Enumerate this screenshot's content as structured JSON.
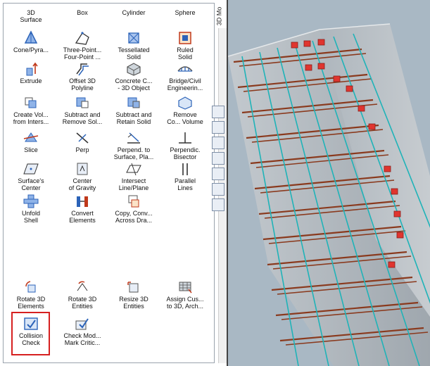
{
  "panel": {
    "vertical_title": "3D Mo",
    "tools": [
      {
        "id": "3d-surface",
        "label": "3D\nSurface",
        "icon": "surface-icon"
      },
      {
        "id": "box",
        "label": "Box",
        "icon": "box-icon"
      },
      {
        "id": "cylinder",
        "label": "Cylinder",
        "icon": "cylinder-icon"
      },
      {
        "id": "sphere",
        "label": "Sphere",
        "icon": "sphere-icon"
      },
      {
        "id": "cone",
        "label": "Cone/Pyra...",
        "icon": "cone-icon"
      },
      {
        "id": "three-point",
        "label": "Three-Point...\nFour-Point ...",
        "icon": "three-point-icon"
      },
      {
        "id": "tessellated",
        "label": "Tessellated\nSolid",
        "icon": "tessellated-icon"
      },
      {
        "id": "ruled",
        "label": "Ruled\nSolid",
        "icon": "ruled-solid-icon"
      },
      {
        "id": "extrude",
        "label": "Extrude",
        "icon": "extrude-icon"
      },
      {
        "id": "offset-polyline",
        "label": "Offset 3D\nPolyline",
        "icon": "offset-polyline-icon"
      },
      {
        "id": "concrete",
        "label": "Concrete C...\n- 3D Object",
        "icon": "concrete-icon"
      },
      {
        "id": "bridge",
        "label": "Bridge/Civil\nEngineerin...",
        "icon": "bridge-icon"
      },
      {
        "id": "create-volume",
        "label": "Create Vol...\nfrom Inters...",
        "icon": "create-volume-icon"
      },
      {
        "id": "subtract-remove",
        "label": "Subtract and\nRemove Sol...",
        "icon": "subtract-remove-icon"
      },
      {
        "id": "subtract-retain",
        "label": "Subtract and\nRetain Solid",
        "icon": "subtract-retain-icon"
      },
      {
        "id": "remove-common",
        "label": "Remove\nCo... Volume",
        "icon": "remove-volume-icon"
      },
      {
        "id": "slice",
        "label": "Slice",
        "icon": "slice-icon"
      },
      {
        "id": "perp",
        "label": "Perp",
        "icon": "perp-icon"
      },
      {
        "id": "perpend-surface",
        "label": "Perpend. to\nSurface, Pla...",
        "icon": "perpend-surface-icon"
      },
      {
        "id": "perpendic-bisector",
        "label": "Perpendic.\nBisector",
        "icon": "bisector-icon"
      },
      {
        "id": "surface-center",
        "label": "Surface's\nCenter",
        "icon": "surface-center-icon"
      },
      {
        "id": "center-gravity",
        "label": "Center\nof Gravity",
        "icon": "center-gravity-icon"
      },
      {
        "id": "intersect-line",
        "label": "Intersect\nLine/Plane",
        "icon": "intersect-icon"
      },
      {
        "id": "parallel-lines",
        "label": "Parallel\nLines",
        "icon": "parallel-lines-icon"
      },
      {
        "id": "unfold-shell",
        "label": "Unfold\nShell",
        "icon": "unfold-icon"
      },
      {
        "id": "convert-elements",
        "label": "Convert\nElements",
        "icon": "convert-icon"
      },
      {
        "id": "copy-conv",
        "label": "Copy, Conv...\nAcross Dra...",
        "icon": "copy-convert-icon"
      },
      {
        "id": "rotate-3d-elements",
        "label": "Rotate 3D\nElements",
        "icon": "rotate-elements-icon"
      },
      {
        "id": "rotate-3d-entities",
        "label": "Rotate 3D\nEntities",
        "icon": "rotate-entities-icon"
      },
      {
        "id": "resize-3d",
        "label": "Resize 3D\nEntities",
        "icon": "resize-icon"
      },
      {
        "id": "assign-cus",
        "label": "Assign Cus...\nto 3D, Arch...",
        "icon": "assign-icon"
      },
      {
        "id": "collision-check",
        "label": "Collision\nCheck",
        "icon": "collision-check-icon"
      },
      {
        "id": "check-mod",
        "label": "Check Mod...\nMark Critic...",
        "icon": "check-mod-icon"
      }
    ]
  },
  "colors": {
    "highlight": "#d62020",
    "icon_blue": "#2c63b8",
    "rebar_cyan": "#1fb3b8",
    "rebar_brown": "#8a3a1e",
    "marker_red": "#e0352f",
    "solid_gray": "#b9c0c6"
  }
}
